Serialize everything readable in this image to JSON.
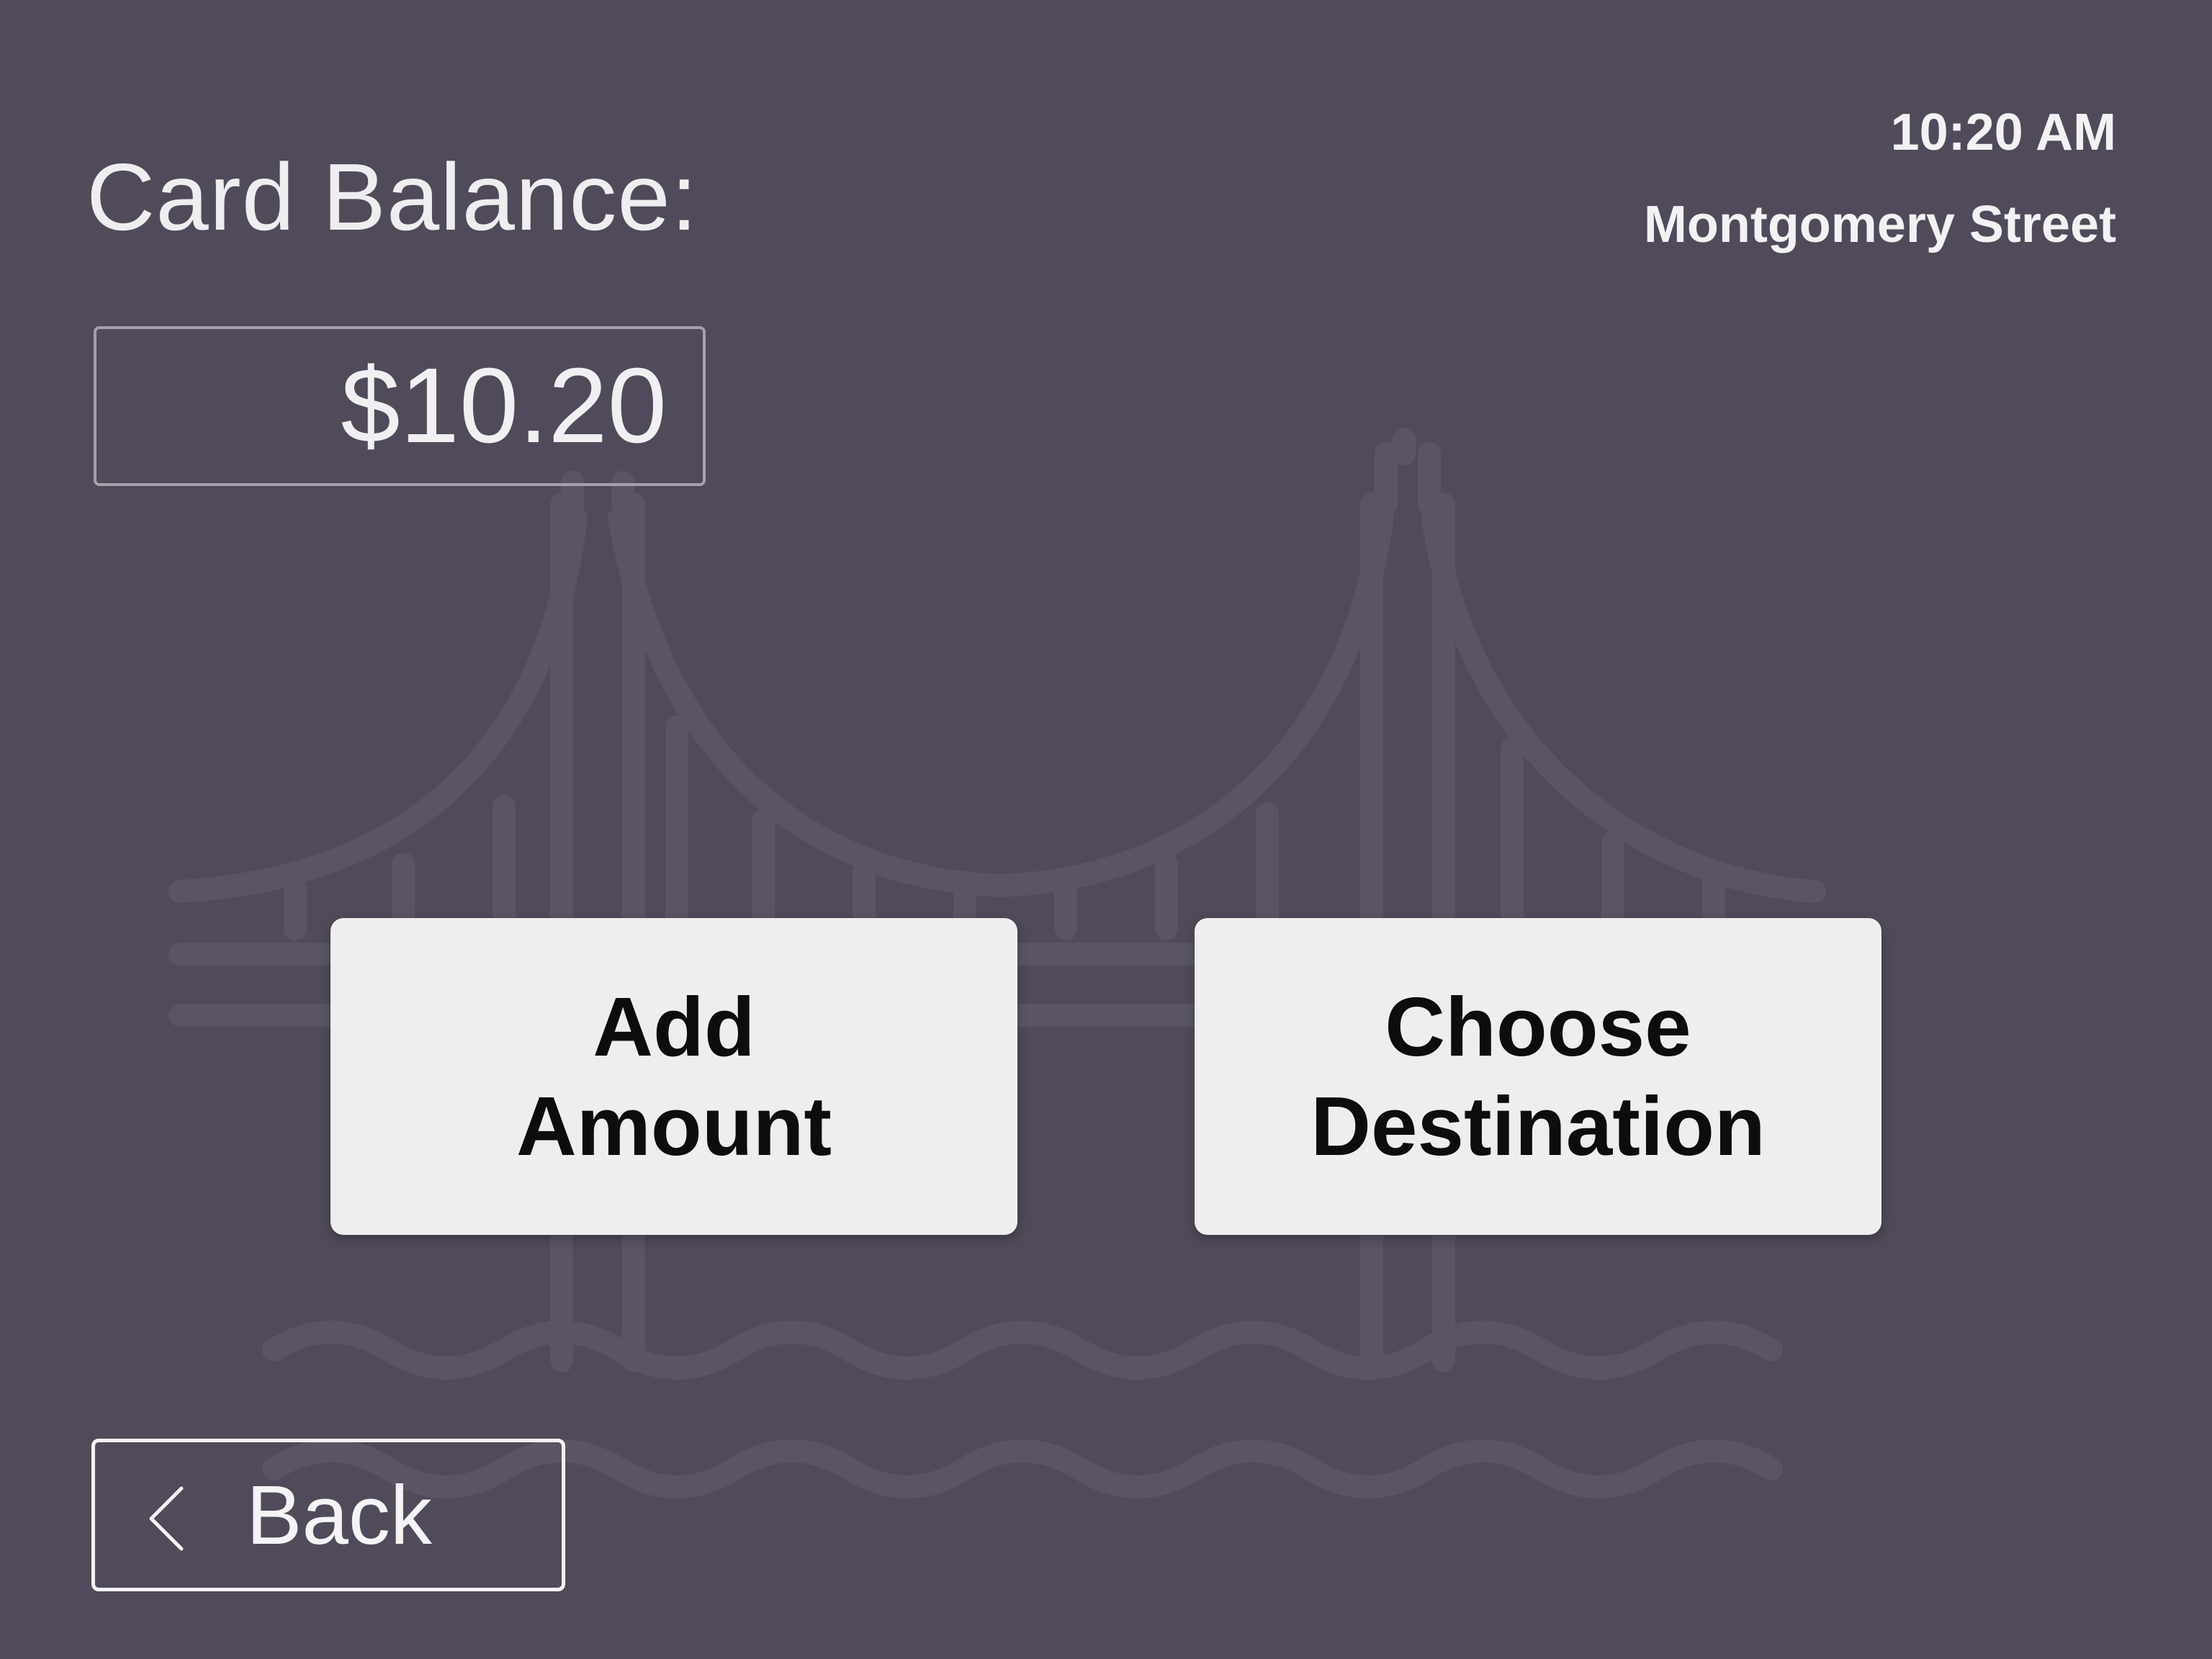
{
  "header": {
    "balance_title": "Card Balance:",
    "balance_value": "$10.20",
    "time": "10:20 AM",
    "station": "Montgomery Street"
  },
  "actions": {
    "add_amount_line1": "Add",
    "add_amount_line2": "Amount",
    "choose_destination_line1": "Choose",
    "choose_destination_line2": "Destination"
  },
  "navigation": {
    "back_label": "Back",
    "back_icon": "chevron-left-icon"
  },
  "background": {
    "illustration": "bridge-icon"
  },
  "colors": {
    "background": "#504a5a",
    "button_fill": "#eeeeee",
    "text_light": "#f2f2f4",
    "text_dark": "#0d0d0d"
  }
}
